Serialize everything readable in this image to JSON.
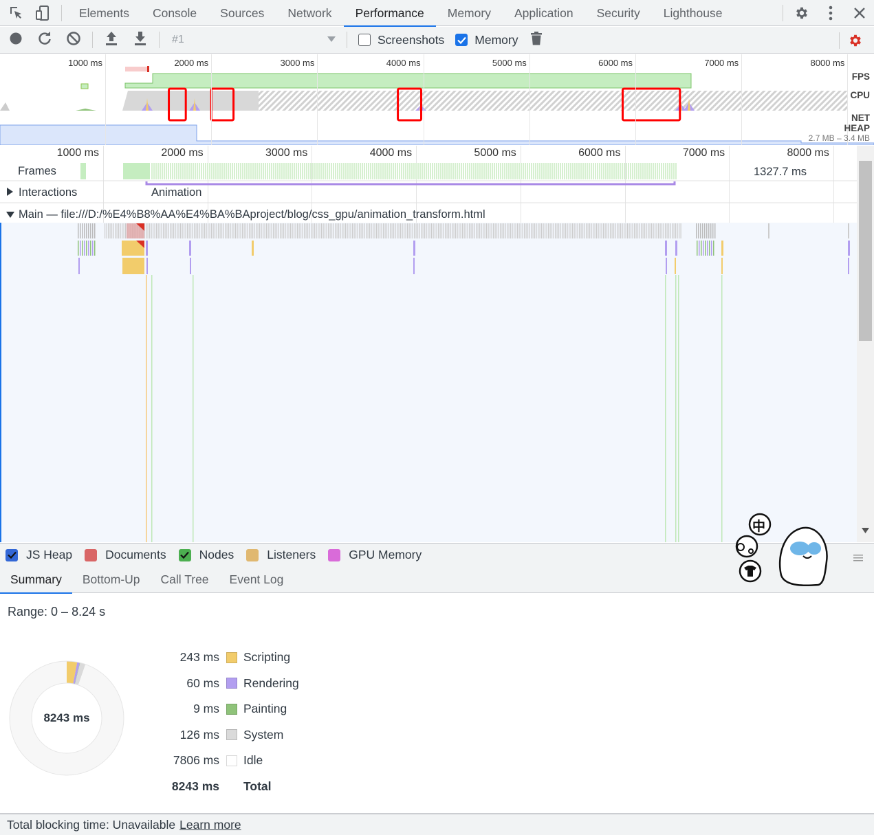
{
  "colors": {
    "accent": "#1a73e8",
    "recordRed": "#d93025",
    "scripting": "#f2cc6b",
    "rendering": "#b29ef0",
    "painting": "#8fc37a",
    "system": "#dadada",
    "idle": "#ffffff",
    "fps": "#c5edc0",
    "heap": "#dbe6fb",
    "highlight": "#ff0000"
  },
  "topbar": {
    "tabs": [
      "Elements",
      "Console",
      "Sources",
      "Network",
      "Performance",
      "Memory",
      "Application",
      "Security",
      "Lighthouse"
    ],
    "active_tab": "Performance",
    "icons": [
      "inspect-icon",
      "device-toggle-icon",
      "settings-gear-icon",
      "more-vert-icon",
      "close-icon"
    ]
  },
  "toolbar": {
    "profile_value": "#1",
    "screenshots_label": "Screenshots",
    "screenshots_checked": false,
    "memory_label": "Memory",
    "memory_checked": true,
    "icons": [
      "record-icon",
      "reload-icon",
      "clear-icon",
      "upload-icon",
      "download-icon",
      "chevron-down-icon",
      "trash-icon",
      "capture-settings-gear-icon"
    ]
  },
  "overview": {
    "ticks": [
      "1000 ms",
      "2000 ms",
      "3000 ms",
      "4000 ms",
      "5000 ms",
      "6000 ms",
      "7000 ms",
      "8000 ms"
    ],
    "tracks": [
      "FPS",
      "CPU",
      "NET",
      "HEAP"
    ],
    "heap_range": "2.7 MB – 3.4 MB",
    "highlight_regions_ms": [
      [
        1600,
        1760
      ],
      [
        2000,
        2210
      ],
      [
        3760,
        3980
      ],
      [
        5880,
        6420
      ]
    ]
  },
  "timeline": {
    "ticks": [
      "1000 ms",
      "2000 ms",
      "3000 ms",
      "4000 ms",
      "5000 ms",
      "6000 ms",
      "7000 ms",
      "8000 ms"
    ],
    "frames_label": "Frames",
    "frames_value": "1327.7 ms",
    "interactions_label": "Interactions",
    "animation_label": "Animation",
    "main_label": "Main — file:///D:/%E4%B8%AA%E4%BA%BAproject/blog/css_gpu/animation_transform.html"
  },
  "counters": [
    {
      "label": "JS Heap",
      "color": "#3367d6",
      "checked": true
    },
    {
      "label": "Documents",
      "color": "#d96666",
      "checked": false
    },
    {
      "label": "Nodes",
      "color": "#4caf50",
      "checked": true
    },
    {
      "label": "Listeners",
      "color": "#e0b870",
      "checked": false
    },
    {
      "label": "GPU Memory",
      "color": "#d96bd9",
      "checked": false
    }
  ],
  "details": {
    "tabs": [
      "Summary",
      "Bottom-Up",
      "Call Tree",
      "Event Log"
    ],
    "active_tab": "Summary"
  },
  "summary": {
    "range": "Range: 0 – 8.24 s",
    "center": "8243 ms",
    "rows": [
      {
        "value": "243 ms",
        "label": "Scripting",
        "ms": 243,
        "color": "#f2cc6b"
      },
      {
        "value": "60 ms",
        "label": "Rendering",
        "ms": 60,
        "color": "#b29ef0"
      },
      {
        "value": "9 ms",
        "label": "Painting",
        "ms": 9,
        "color": "#8fc37a"
      },
      {
        "value": "126 ms",
        "label": "System",
        "ms": 126,
        "color": "#dadada"
      },
      {
        "value": "7806 ms",
        "label": "Idle",
        "ms": 7806,
        "color": "#ffffff"
      }
    ],
    "total_value": "8243 ms",
    "total_label": "Total"
  },
  "footer": {
    "text": "Total blocking time: Unavailable",
    "link": "Learn more"
  },
  "sticker": {
    "glyph": "中"
  }
}
